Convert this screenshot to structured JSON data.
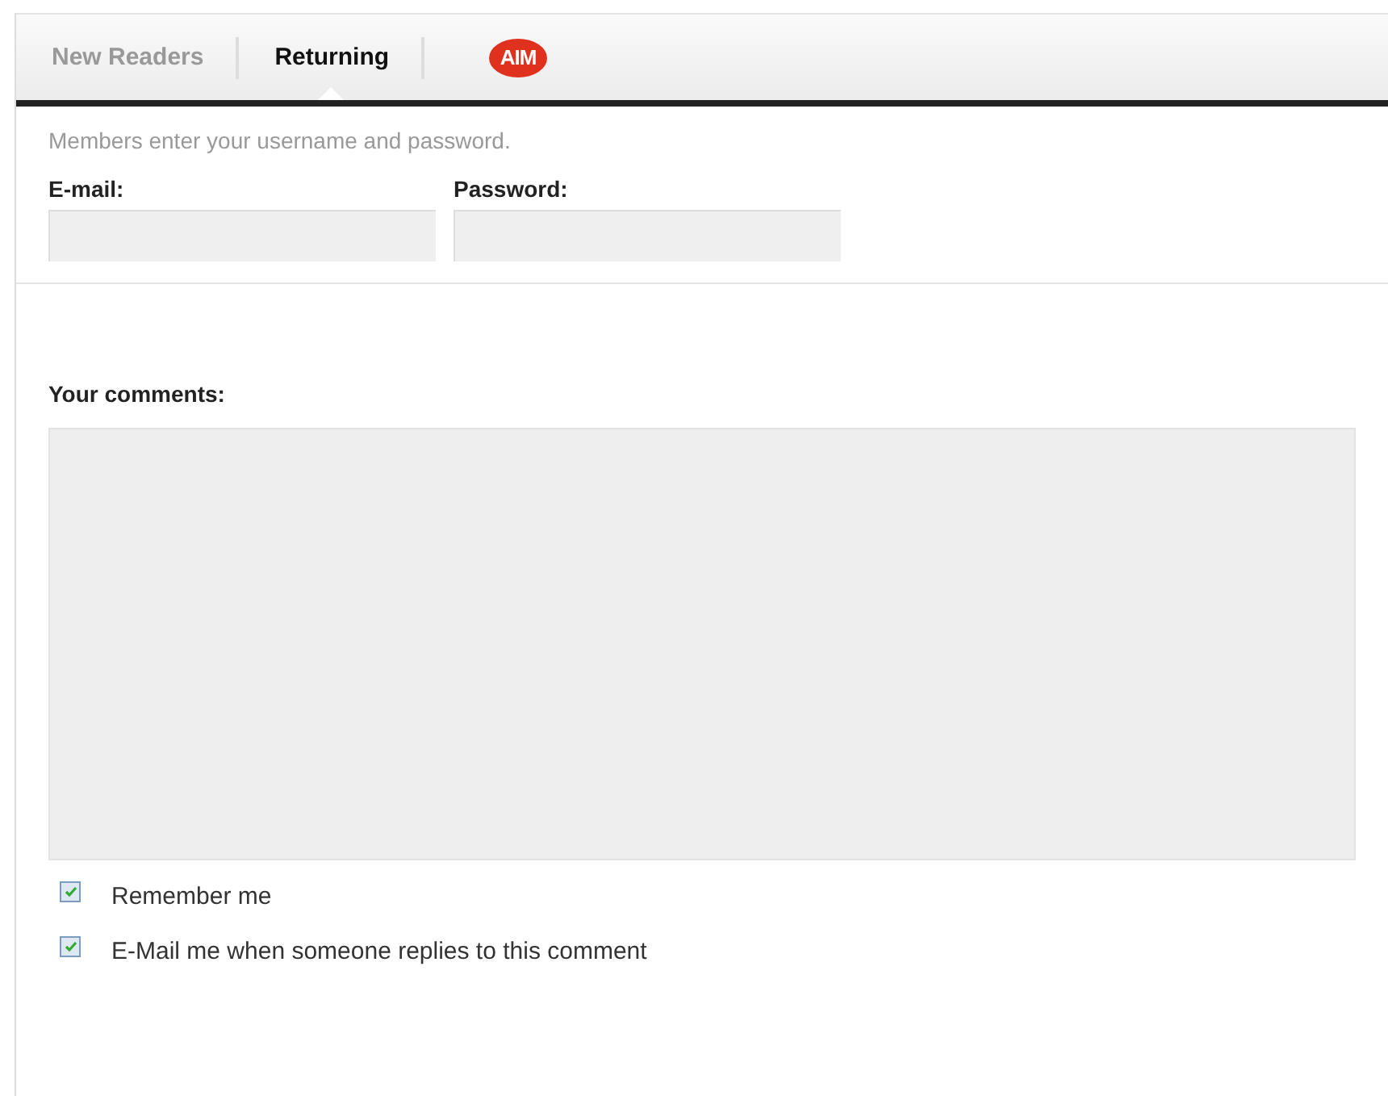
{
  "tabs": [
    {
      "label": "New Readers",
      "selected": false
    },
    {
      "label": "Returning",
      "selected": true
    }
  ],
  "logo": {
    "text": "AIM"
  },
  "login": {
    "hint": "Members enter your username and password.",
    "fields": [
      {
        "label": "E-mail:"
      },
      {
        "label": "Password:"
      }
    ]
  },
  "comments": {
    "label": "Your comments:"
  },
  "options": [
    {
      "label": "Remember me",
      "checked": true
    },
    {
      "label": "E-Mail me when someone replies to this comment",
      "checked": true
    }
  ]
}
